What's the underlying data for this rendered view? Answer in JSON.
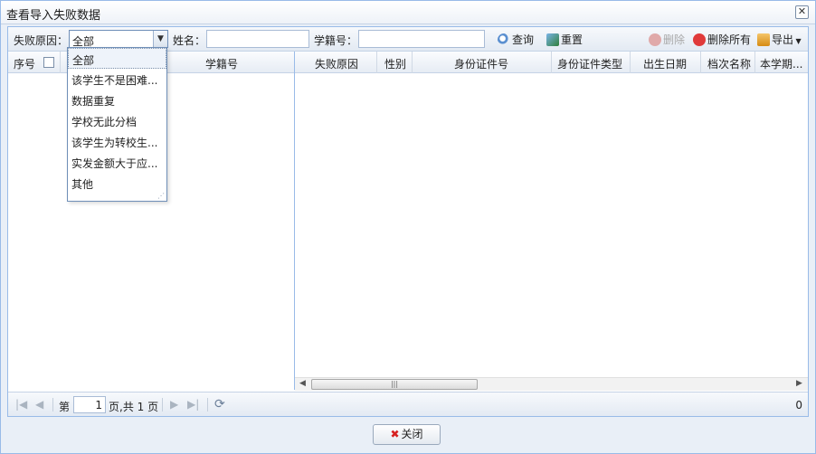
{
  "window": {
    "title": "查看导入失败数据"
  },
  "toolbar": {
    "reason_label": "失败原因：",
    "reason_value": "全部",
    "name_label": "姓名：",
    "student_no_label": "学籍号：",
    "search": "查询",
    "reset": "重置",
    "delete": "删除",
    "delete_all": "删除所有",
    "export": "导出"
  },
  "left_grid": {
    "columns": {
      "seq": "序号",
      "student_no": "学籍号"
    }
  },
  "right_grid": {
    "columns": [
      "失败原因",
      "性别",
      "身份证件号",
      "身份证件类型",
      "出生日期",
      "档次名称",
      "本学期..."
    ]
  },
  "dropdown": {
    "options": [
      "全部",
      "该学生不是困难...",
      "数据重复",
      "学校无此分档",
      "该学生为转校生...",
      "实发金额大于应...",
      "其他"
    ]
  },
  "pager": {
    "page_prefix": "第",
    "page_value": "1",
    "page_suffix": "页,共 1 页",
    "total": "0"
  },
  "footer": {
    "close": "关闭"
  },
  "icons": {
    "close_window": "close-icon",
    "search": "search-icon",
    "reset": "reset-icon",
    "delete": "delete-icon",
    "delete_all": "delete-all-icon",
    "export": "export-icon",
    "refresh": "refresh-icon"
  },
  "colors": {
    "border": "#99bbe8",
    "delete_all": "#e03a3a",
    "close_icon": "#d62020"
  }
}
